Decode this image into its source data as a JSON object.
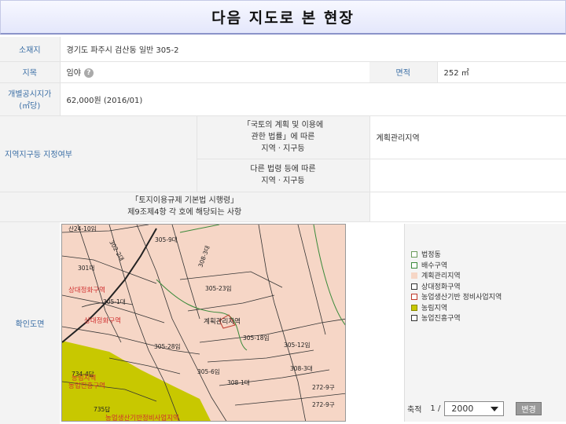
{
  "title": "다음 지도로 본 현장",
  "location": {
    "label": "소재지",
    "value": "경기도 파주시 검산동 일반 305-2"
  },
  "land_category": {
    "label": "지목",
    "value": "임야",
    "help": "?"
  },
  "area": {
    "label": "면적",
    "value": "252 ㎡"
  },
  "official_price": {
    "label_line1": "개별공시지가",
    "label_line2": "(㎡당)",
    "value": "62,000원 (2016/01)"
  },
  "zoning": {
    "label": "지역지구등 지정여부",
    "sub1_line1": "「국토의 계획 및 이용에",
    "sub1_line2": "관한 법률」에 따른",
    "sub1_line3": "지역ㆍ지구등",
    "sub1_value": "계획관리지역",
    "sub2_line1": "다른 법령 등에 따른",
    "sub2_line2": "지역ㆍ지구등",
    "sub2_value": ""
  },
  "regulation": {
    "line1": "「토지이용규제 기본법 시행령」",
    "line2": "제9조제4항 각 호에 해당되는 사항",
    "value": ""
  },
  "map": {
    "label": "확인도면",
    "parcels": [
      "산24-10임",
      "302-2대",
      "301대",
      "305-1대",
      "305-9대",
      "308-3대",
      "305-23임",
      "305-18임",
      "305-28임",
      "305-12임",
      "305-6임",
      "308-3대",
      "734-4답",
      "735답",
      "272-9구",
      "308-1대",
      "272-9구"
    ],
    "zone_labels": [
      "상대정화구역",
      "상대정화구역",
      "계획관리지역",
      "농림지역",
      "농업진흥구역",
      "농업생산기반정비사업지역"
    ]
  },
  "legend": [
    {
      "label": "법정동",
      "color": "#ffffff",
      "border": "#6a9a5a"
    },
    {
      "label": "배수구역",
      "color": "#ffffff",
      "border": "#3a8a3a"
    },
    {
      "label": "계획관리지역",
      "color": "#f6d6c6",
      "border": "#f6d6c6"
    },
    {
      "label": "상대정화구역",
      "color": "#ffffff",
      "border": "#333333"
    },
    {
      "label": "농업생산기반 정비사업지역",
      "color": "#ffffff",
      "border": "#c0392b"
    },
    {
      "label": "농림지역",
      "color": "#c8c800",
      "border": "#8a8a00"
    },
    {
      "label": "농업진흥구역",
      "color": "#ffffff",
      "border": "#333333"
    }
  ],
  "scale": {
    "label": "축적",
    "prefix": "1 /",
    "value": "2000",
    "button": "변경"
  }
}
